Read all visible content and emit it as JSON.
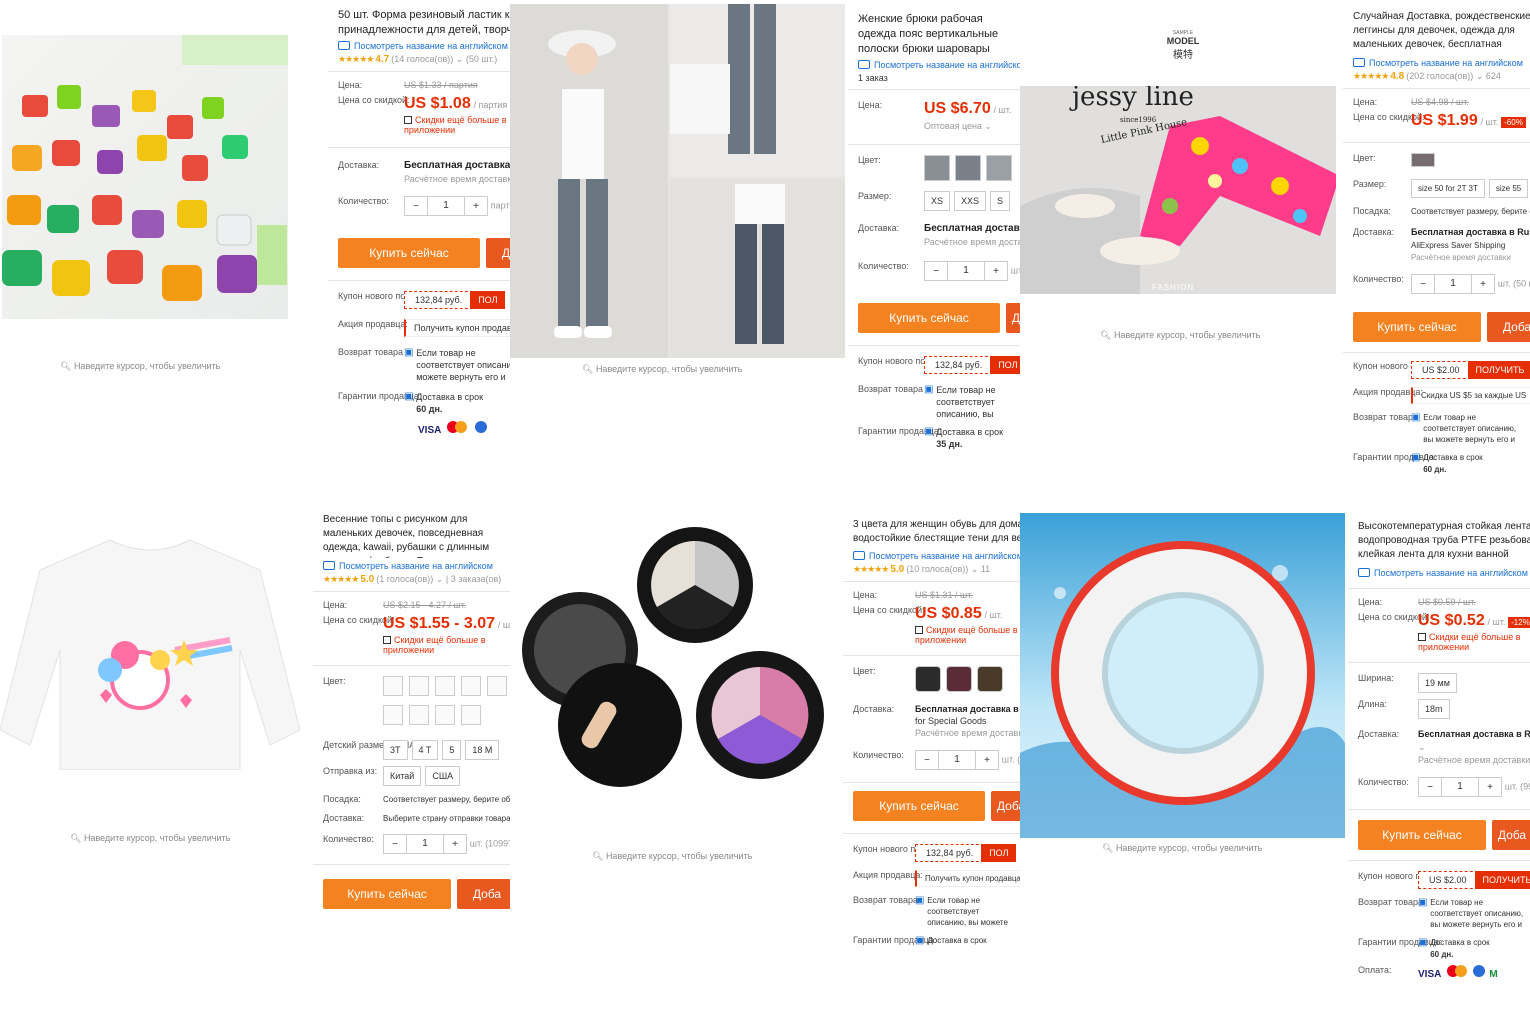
{
  "common": {
    "zoom_hint": "Наведите курсор, чтобы увеличить",
    "translate_link": "Посмотреть название на английском",
    "buy_now": "Купить сейчас",
    "add_short": "Доба",
    "label_price": "Цена:",
    "label_sale": "Цена со скидкой:",
    "label_color": "Цвет:",
    "label_size": "Размер:",
    "label_shipping": "Доставка:",
    "label_qty": "Количество:",
    "label_coupon": "Купон нового пользователя",
    "label_promo": "Акция продавца:",
    "label_return": "Возврат товара",
    "label_guarantee": "Гарантии продавца:",
    "label_fit": "Посадка:",
    "label_ship_from": "Отправка из:",
    "label_payment": "Оплата:",
    "label_width": "Ширина:",
    "label_length": "Длина:",
    "label_kids_size": "Детский размер (США):",
    "free_shipping": "Бесплатная доставка",
    "delivery_time": "Расчётное время доставки",
    "coupon_value": "132,84 руб.",
    "coupon_get": "ПОЛУЧИТЬ",
    "coupon_short": "ПОЛ",
    "promo_coupon": "Получить купон продавца",
    "return_text": "Если товар не соответствует описанию, вы можете вернуть его и оплатить стоимость обратной доставки или договориться о компенсации",
    "guarantee_text": "Доставка в срок",
    "app_discount": "Скидки ещё больше в приложении",
    "fit_text": "Соответствует размеру, берите обычный размер",
    "qty_value": "1",
    "minus": "−",
    "plus": "+",
    "pay_visa": "VISA",
    "pay_m": "M"
  },
  "products": [
    {
      "title": "50 шт. Форма резиновый ластик канцелярские принадлежности для детей, творчество",
      "rating": "4.7",
      "reviews": "(14 голоса(ов))",
      "orders": "(50 шт.)",
      "old_price": "US $1.33 / партия",
      "price": "US $1.08",
      "unit": "/ партия",
      "delivery": "Бесплатная доставка",
      "qty_unit": "партия",
      "guarantee_days": "60 дн."
    },
    {
      "title": "Женские брюки рабочая одежда пояс вертикальные полоски брюки шаровары",
      "orders": "1 заказ",
      "price": "US $6.70",
      "unit": "/ шт.",
      "wholesale": "Оптовая цена",
      "sizes": [
        "XS",
        "XXS",
        "S"
      ],
      "delivery": "Бесплатная доставка",
      "qty_unit": "шт.",
      "guarantee_days": "35 дн."
    },
    {
      "title": "Случайная Доставка, рождественские леггинсы для девочек, одежда для маленьких девочек, бесплатная доставка",
      "rating": "4.8",
      "reviews": "(202 голоса(ов))",
      "orders": "624",
      "old_price": "US $4.98 / шт.",
      "price": "US $1.99",
      "unit": "/ шт.",
      "discount": "-60%",
      "sizes": [
        "size 50 for 2T 3T",
        "size 55"
      ],
      "delivery": "Бесплатная доставка в Russian Federation",
      "delivery_sub": "AliExpress Saver Shipping",
      "qty_unit": "шт. (50 шт.)",
      "coupon": "US $2.00",
      "promo": "Скидка US $5 за каждые US",
      "guarantee_days": "60 дн.",
      "img_brand": "jessy line",
      "img_since": "since1996",
      "img_sub": "Little Pink House",
      "img_fashion": "FASHION",
      "model_top": "SAMPLE",
      "model": "MODEL",
      "model_cn": "模特"
    },
    {
      "title": "Весенние топы с рисунком для маленьких девочек, повседневная одежда, kawaii, рубашки с длинным рукавом, футболки, Топ",
      "rating": "5.0",
      "reviews": "(1 голоса(ов))",
      "orders": "3 заказа(ов)",
      "old_price": "US $2.15 - 4.27 / шт.",
      "price": "US $1.55 - 3.07",
      "unit": "/ шт.",
      "sizes": [
        "3T",
        "4 T",
        "5",
        "18 M"
      ],
      "ship_from": [
        "Китай",
        "США"
      ],
      "delivery": "Выберите страну отправки товара",
      "qty_unit": "шт. (10997 шт.)"
    },
    {
      "title": "3 цвета для женщин обувь для дома водостойкие блестящие тени для век",
      "rating": "5.0",
      "reviews": "(10 голоса(ов))",
      "orders": "11",
      "old_price": "US $1.31 / шт.",
      "price": "US $0.85",
      "unit": "/ шт.",
      "delivery": "Бесплатная доставка в",
      "delivery_sub": "for Special Goods",
      "qty_unit": "шт. (9"
    },
    {
      "title": "Высокотемпературная стойкая лента водопроводная труба PTFE резьбовая клейкая лента для кухни ванной комнаты",
      "old_price": "US $0.59 / шт.",
      "price": "US $0.52",
      "unit": "/ шт.",
      "discount": "-12%",
      "width": "19 мм",
      "length": "18m",
      "delivery": "Бесплатная доставка в Russian Federation",
      "qty_unit": "шт. (9999",
      "coupon": "US $2.00",
      "guarantee_days": "60 дн."
    }
  ],
  "brand_colors": {
    "orange": "#f58220",
    "red": "#e62e04",
    "link": "#1a6fd6",
    "star": "#f2a20c"
  }
}
